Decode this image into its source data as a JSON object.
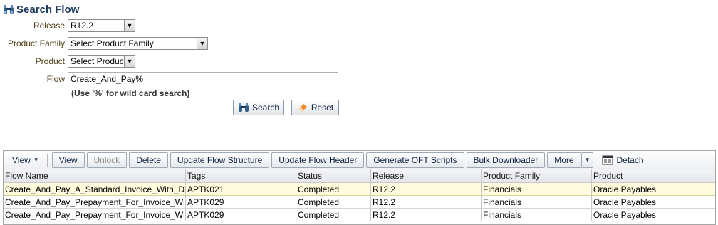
{
  "page": {
    "title": "Search Flow"
  },
  "form": {
    "release_label": "Release",
    "release_value": "R12.2",
    "family_label": "Product Family",
    "family_value": "Select Product Family",
    "product_label": "Product",
    "product_value": "Select Product",
    "flow_label": "Flow",
    "flow_value": "Create_And_Pay%",
    "hint": "(Use '%' for wild card search)",
    "search_label": "Search",
    "reset_label": "Reset"
  },
  "toolbar": {
    "view_menu": "View",
    "view": "View",
    "unlock": "Unlock",
    "delete": "Delete",
    "update_structure": "Update Flow Structure",
    "update_header": "Update Flow Header",
    "generate_oft": "Generate OFT Scripts",
    "bulk": "Bulk Downloader",
    "more": "More",
    "detach": "Detach"
  },
  "table": {
    "columns": [
      "Flow Name",
      "Tags",
      "Status",
      "Release",
      "Product Family",
      "Product"
    ],
    "rows": [
      [
        "Create_And_Pay_A_Standard_Invoice_With_Distribution",
        "APTK021",
        "Completed",
        "R12.2",
        "Financials",
        "Oracle Payables"
      ],
      [
        "Create_And_Pay_Prepayment_For_Invoice_With_Lines",
        "APTK029",
        "Completed",
        "R12.2",
        "Financials",
        "Oracle Payables"
      ],
      [
        "Create_And_Pay_Prepayment_For_Invoice_With_Matching",
        "APTK029",
        "Completed",
        "R12.2",
        "Financials",
        "Oracle Payables"
      ]
    ]
  }
}
